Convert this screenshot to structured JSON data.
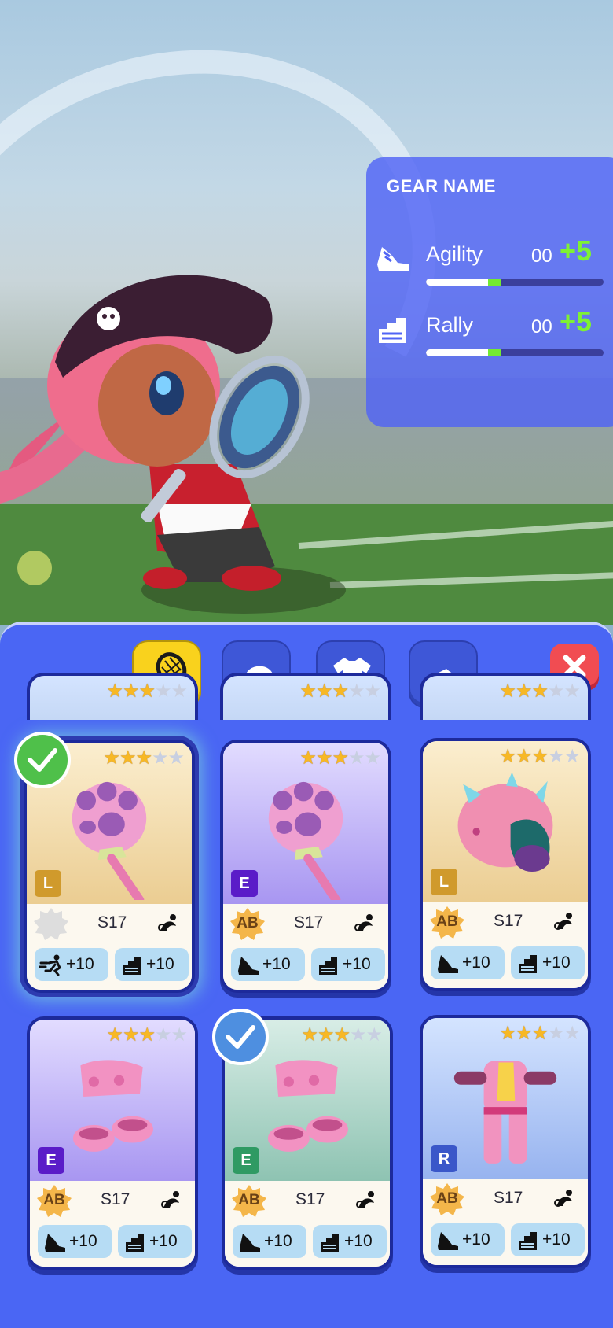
{
  "gear_panel": {
    "title": "GEAR NAME",
    "stats": [
      {
        "name": "Agility",
        "value": "00",
        "bonus": "+5",
        "icon": "agility-shoe-icon",
        "fill": 0.35,
        "bonus_fill": 0.07
      },
      {
        "name": "Rally",
        "value": "00",
        "bonus": "+5",
        "icon": "rally-stairs-icon",
        "fill": 0.35,
        "bonus_fill": 0.07
      }
    ]
  },
  "tabs": [
    {
      "name": "racket",
      "icon": "racket-icon",
      "active": true
    },
    {
      "name": "hat",
      "icon": "cap-icon",
      "active": false
    },
    {
      "name": "shirt",
      "icon": "shirt-icon",
      "active": false
    },
    {
      "name": "shoes",
      "icon": "sneaker-icon",
      "active": false
    }
  ],
  "close_icon": "close-icon",
  "colors": {
    "panel": "#5064f5",
    "inventory": "#4a66f4",
    "bonus_green": "#7ef233",
    "active_tab": "#f9d21d",
    "close": "#f14c52"
  },
  "cards": [
    {
      "stars": 3,
      "rarity": "L",
      "badge": "",
      "season": "S17",
      "stat1": "+10",
      "stat2": "+10",
      "stat1_icon": "dash-runner-icon",
      "stat2_icon": "rally-stairs-icon",
      "item": "paw-racket",
      "check": "equipped"
    },
    {
      "stars": 3,
      "rarity": "E",
      "badge": "AB",
      "season": "S17",
      "stat1": "+10",
      "stat2": "+10",
      "stat1_icon": "agility-shoe-icon",
      "stat2_icon": "rally-stairs-icon",
      "item": "paw-racket",
      "check": ""
    },
    {
      "stars": 3,
      "rarity": "L",
      "badge": "AB",
      "season": "S17",
      "stat1": "+10",
      "stat2": "+10",
      "stat1_icon": "agility-shoe-icon",
      "stat2_icon": "rally-stairs-icon",
      "item": "dino-head",
      "check": ""
    },
    {
      "stars": 3,
      "rarity": "E",
      "badge": "AB",
      "season": "S17",
      "stat1": "+10",
      "stat2": "+10",
      "stat1_icon": "agility-shoe-icon",
      "stat2_icon": "rally-stairs-icon",
      "item": "paw-gloves",
      "check": ""
    },
    {
      "stars": 3,
      "rarity": "E",
      "badge": "AB",
      "season": "S17",
      "stat1": "+10",
      "stat2": "+10",
      "stat1_icon": "agility-shoe-icon",
      "stat2_icon": "rally-stairs-icon",
      "item": "paw-gloves",
      "check": "selected"
    },
    {
      "stars": 3,
      "rarity": "R",
      "badge": "AB",
      "season": "S17",
      "stat1": "+10",
      "stat2": "+10",
      "stat1_icon": "agility-shoe-icon",
      "stat2_icon": "rally-stairs-icon",
      "item": "dino-suit",
      "check": ""
    }
  ],
  "partial_cards": [
    {
      "stars": 3
    },
    {
      "stars": 3
    },
    {
      "stars": 3
    }
  ]
}
